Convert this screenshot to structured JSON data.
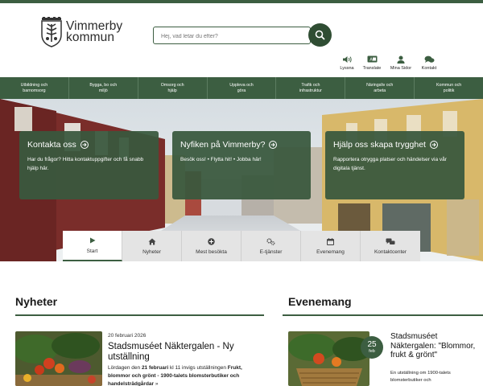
{
  "brand": {
    "name_line1": "Vimmerby",
    "name_line2": "kommun",
    "color": "#3c5e41"
  },
  "search": {
    "placeholder": "Hej, vad letar du efter?",
    "icon": "search-icon"
  },
  "tools": [
    {
      "label": "Lyssna",
      "icon": "speaker-icon"
    },
    {
      "label": "Translate",
      "icon": "translate-icon"
    },
    {
      "label": "Mina Sidor",
      "icon": "user-icon"
    },
    {
      "label": "Kontakt",
      "icon": "chat-icon"
    }
  ],
  "nav": [
    {
      "line1": "Utbildning och",
      "line2": "barnomsorg"
    },
    {
      "line1": "Bygga, bo och",
      "line2": "miljö"
    },
    {
      "line1": "Omsorg och",
      "line2": "hjälp"
    },
    {
      "line1": "Uppleva och",
      "line2": "göra"
    },
    {
      "line1": "Trafik och",
      "line2": "infrastruktur"
    },
    {
      "line1": "Näringsliv och",
      "line2": "arbeta"
    },
    {
      "line1": "Kommun och",
      "line2": "politik"
    }
  ],
  "hero_cards": [
    {
      "title": "Kontakta oss",
      "text": "Har du frågor? Hitta kontaktuppgifter och få snabb hjälp här."
    },
    {
      "title": "Nyfiken på Vimmerby?",
      "text": "Besök oss! • Flytta hit! • Jobba här!"
    },
    {
      "title": "Hjälp oss skapa trygghet",
      "text": "Rapportera otrygga platser och händelser via vår digitala tjänst."
    }
  ],
  "tabs": [
    {
      "label": "Start",
      "icon": "play-icon",
      "active": true
    },
    {
      "label": "Nyheter",
      "icon": "home-icon",
      "active": false
    },
    {
      "label": "Mest besökta",
      "icon": "plus-circle-icon",
      "active": false
    },
    {
      "label": "E-tjänster",
      "icon": "cogs-icon",
      "active": false
    },
    {
      "label": "Evenemang",
      "icon": "calendar-icon",
      "active": false
    },
    {
      "label": "Kontaktcenter",
      "icon": "chat-icon",
      "active": false
    }
  ],
  "news": {
    "heading": "Nyheter",
    "date": "20 februari 2026",
    "title": "Stadsmuséet Näktergalen - Ny utställning",
    "text_pre": "Lördagen den ",
    "text_bold1": "21 februari",
    "text_mid": " kl 11 invigs utställningen ",
    "text_bold2": "Frukt, blommor och grönt - 1900-talets blomsterbutiker och handelsträdgårdar",
    "text_post": " »"
  },
  "events": {
    "heading": "Evenemang",
    "day": "25",
    "month": "feb",
    "title": "Stadsmuséet Näktergalen: \"Blommor, frukt & grönt\"",
    "text": "En utställning om 1900-talets blomsterbutiker och"
  }
}
